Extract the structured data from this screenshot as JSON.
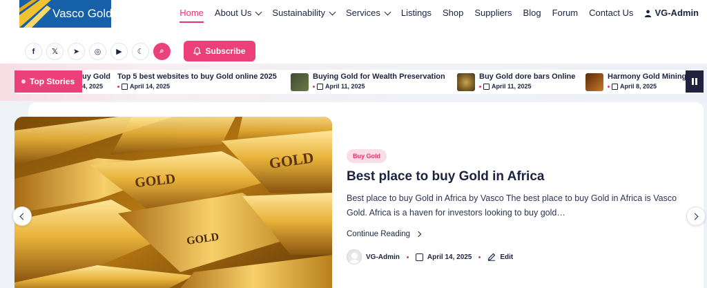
{
  "brand": {
    "name": "Vasco Gold",
    "color": "#1560a8",
    "accent": "#ec407a"
  },
  "nav": {
    "items": [
      {
        "label": "Home",
        "active": true,
        "dropdown": false
      },
      {
        "label": "About Us",
        "dropdown": true
      },
      {
        "label": "Sustainability",
        "dropdown": true
      },
      {
        "label": "Services",
        "dropdown": true
      },
      {
        "label": "Listings",
        "dropdown": false
      },
      {
        "label": "Shop",
        "dropdown": false
      },
      {
        "label": "Suppliers",
        "dropdown": false
      },
      {
        "label": "Blog",
        "dropdown": false
      },
      {
        "label": "Forum",
        "dropdown": false
      },
      {
        "label": "Contact Us",
        "dropdown": false
      }
    ],
    "user": "VG-Admin"
  },
  "social": {
    "icons": [
      "facebook-icon",
      "x-icon",
      "telegram-icon",
      "instagram-icon",
      "youtube-icon",
      "moon-icon",
      "search-icon"
    ],
    "glyphs": [
      "f",
      "𝕏",
      "➤",
      "◎",
      "▶",
      "☾",
      "⌕"
    ]
  },
  "subscribe": {
    "label": "Subscribe"
  },
  "ticker": {
    "label": "Top Stories",
    "items": [
      {
        "title": "uy Gold",
        "date": "4, 2025",
        "thumb": false
      },
      {
        "title": "Top 5 best websites to buy Gold online 2025",
        "date": "April 14, 2025",
        "thumb": false
      },
      {
        "title": "Buying Gold for Wealth Preservation",
        "date": "April 11, 2025",
        "thumb": true,
        "thumb_color": "#4a5a3a"
      },
      {
        "title": "Buy Gold dore bars Online",
        "date": "April 11, 2025",
        "thumb": true,
        "thumb_color": "#8a6a2a"
      },
      {
        "title": "Harmony Gold Mining",
        "date": "April 8, 2025",
        "thumb": true,
        "thumb_color": "#a0551a"
      }
    ]
  },
  "post": {
    "category": "Buy Gold",
    "title": "Best place to buy Gold in Africa",
    "excerpt": "Best place to buy Gold in Africa by Vasco The best place to buy Gold in Africa is Vasco Gold. Africa is a haven for investors looking to buy gold…",
    "read_more": "Continue Reading",
    "author": "VG-Admin",
    "date": "April 14, 2025",
    "edit": "Edit"
  }
}
